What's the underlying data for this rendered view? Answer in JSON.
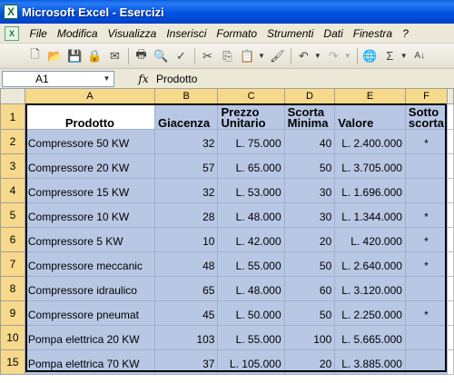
{
  "window": {
    "title": "Microsoft Excel - Esercizi"
  },
  "menu": [
    "File",
    "Modifica",
    "Visualizza",
    "Inserisci",
    "Formato",
    "Strumenti",
    "Dati",
    "Finestra",
    "?"
  ],
  "toolbar_icons": [
    "new-icon",
    "open-icon",
    "save-icon",
    "permission-icon",
    "email-icon",
    "print-icon",
    "print-preview-icon",
    "spelling-icon",
    "cut-icon",
    "copy-icon",
    "paste-icon",
    "format-painter-icon",
    "undo-icon",
    "redo-icon",
    "hyperlink-icon",
    "autosum-icon",
    "sort-ascending-icon"
  ],
  "formula_bar": {
    "name_box": "A1",
    "fx": "fx",
    "content": "Prodotto"
  },
  "columns": [
    "A",
    "B",
    "C",
    "D",
    "E",
    "F"
  ],
  "header_row": {
    "row_number": "1",
    "cells": [
      {
        "line1": "Prodotto",
        "line2": ""
      },
      {
        "line1": "Giacenza",
        "line2": ""
      },
      {
        "line1": "Prezzo",
        "line2": "Unitario"
      },
      {
        "line1": "Scorta",
        "line2": "Minima"
      },
      {
        "line1": "Valore",
        "line2": ""
      },
      {
        "line1": "Sotto",
        "line2": "scorta"
      }
    ]
  },
  "rows": [
    {
      "num": "2",
      "cells": [
        "Compressore 50 KW",
        "32",
        "L. 75.000",
        "40",
        "L. 2.400.000",
        "*"
      ]
    },
    {
      "num": "3",
      "cells": [
        "Compressore 20 KW",
        "57",
        "L. 65.000",
        "50",
        "L. 3.705.000",
        ""
      ]
    },
    {
      "num": "4",
      "cells": [
        "Compressore 15 KW",
        "32",
        "L. 53.000",
        "30",
        "L. 1.696.000",
        ""
      ]
    },
    {
      "num": "5",
      "cells": [
        "Compressore 10 KW",
        "28",
        "L. 48.000",
        "30",
        "L. 1.344.000",
        "*"
      ]
    },
    {
      "num": "6",
      "cells": [
        "Compressore 5 KW",
        "10",
        "L. 42.000",
        "20",
        "L. 420.000",
        "*"
      ]
    },
    {
      "num": "7",
      "cells": [
        "Compressore meccanic",
        "48",
        "L. 55.000",
        "50",
        "L. 2.640.000",
        "*"
      ]
    },
    {
      "num": "8",
      "cells": [
        "Compressore idraulico",
        "65",
        "L. 48.000",
        "60",
        "L. 3.120.000",
        ""
      ]
    },
    {
      "num": "9",
      "cells": [
        "Compressore pneumat",
        "45",
        "L. 50.000",
        "50",
        "L. 2.250.000",
        "*"
      ]
    },
    {
      "num": "10",
      "cells": [
        "Pompa elettrica 20 KW",
        "103",
        "L. 55.000",
        "100",
        "L. 5.665.000",
        ""
      ]
    },
    {
      "num": "15",
      "cells": [
        "Pompa elettrica 70 KW",
        "37",
        "L. 105.000",
        "20",
        "L. 3.885.000",
        ""
      ]
    }
  ],
  "colors": {
    "selection": "#b8c8e4",
    "title_bar": "#0053e0",
    "header_highlight": "#f7d98b"
  }
}
